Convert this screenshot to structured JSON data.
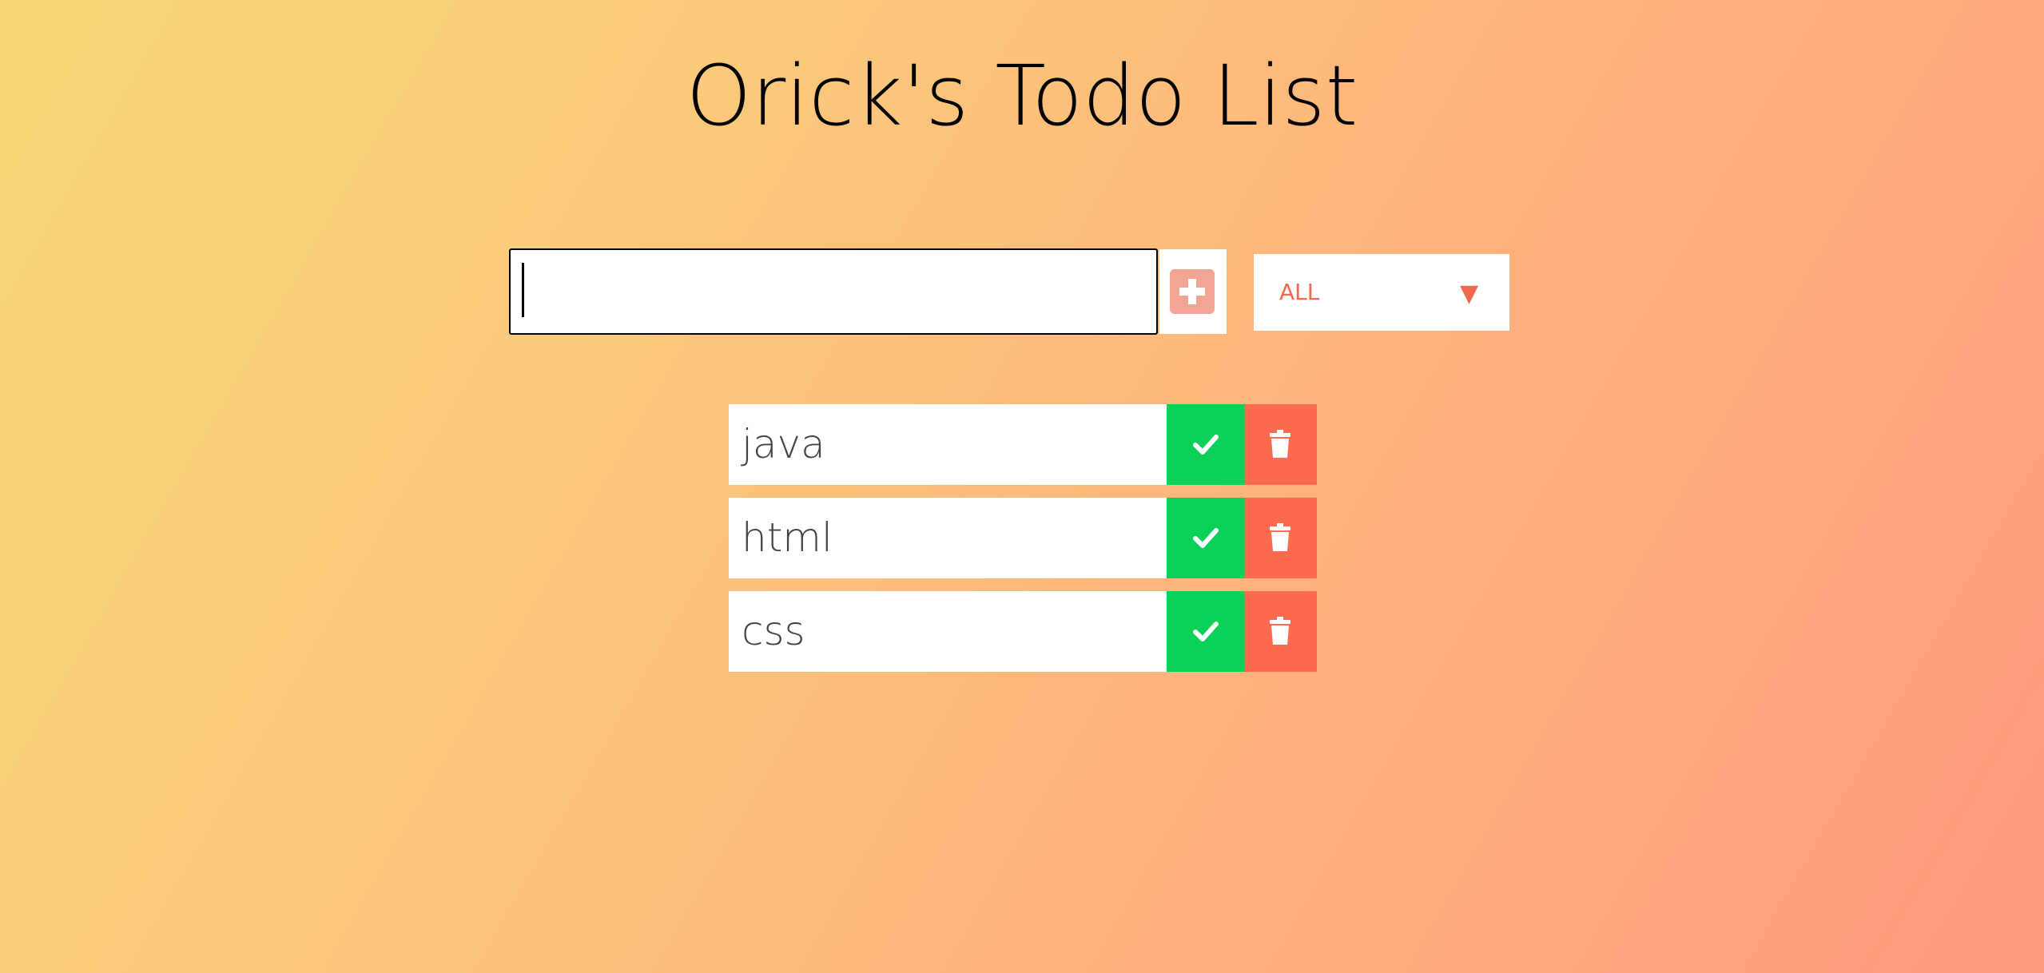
{
  "header": {
    "title": "Orick's Todo List"
  },
  "form": {
    "input_value": "",
    "add_icon": "plus-square-icon",
    "filter": {
      "selected": "ALL",
      "arrow_glyph": "▼"
    }
  },
  "todos": [
    {
      "text": "java",
      "complete_icon": "check-icon",
      "delete_icon": "trash-icon"
    },
    {
      "text": "html",
      "complete_icon": "check-icon",
      "delete_icon": "trash-icon"
    },
    {
      "text": "css",
      "complete_icon": "check-icon",
      "delete_icon": "trash-icon"
    }
  ],
  "colors": {
    "complete": "#0bd158",
    "delete": "#fc6a4f",
    "add_icon": "#f4a494",
    "filter_text": "#ef6a4c"
  }
}
